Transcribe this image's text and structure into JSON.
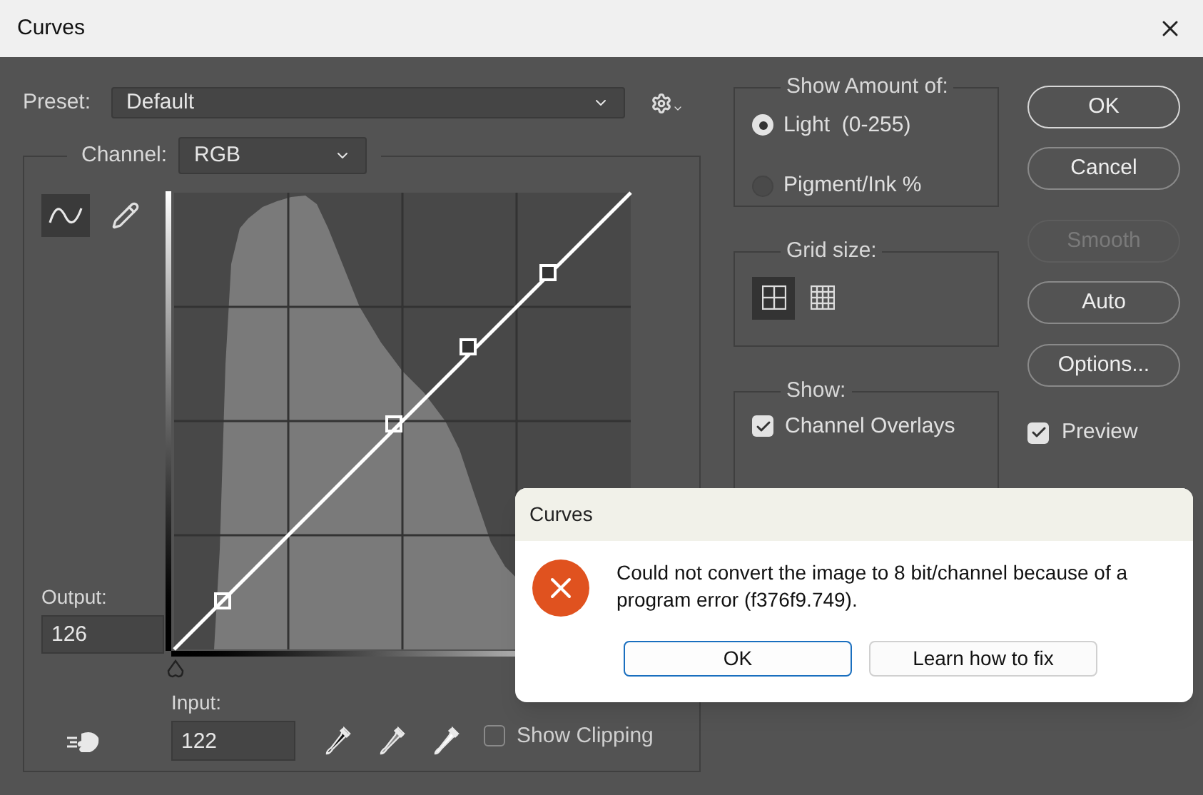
{
  "window": {
    "title": "Curves"
  },
  "preset": {
    "label": "Preset:",
    "value": "Default"
  },
  "channel": {
    "label": "Channel:",
    "value": "RGB"
  },
  "curve_tools": [
    {
      "kind": "curve",
      "selected": true
    },
    {
      "kind": "pencil",
      "selected": false
    }
  ],
  "output": {
    "label": "Output:",
    "value": "126"
  },
  "input": {
    "label": "Input:",
    "value": "122"
  },
  "show_clipping": {
    "label": "Show Clipping",
    "checked": false
  },
  "show_amount": {
    "title": "Show Amount of:",
    "options": [
      {
        "label": "Light  (0-255)",
        "selected": true
      },
      {
        "label": "Pigment/Ink %",
        "selected": false
      }
    ]
  },
  "grid_size": {
    "title": "Grid size:",
    "options": [
      {
        "kind": "simple",
        "selected": true
      },
      {
        "kind": "detailed",
        "selected": false
      }
    ]
  },
  "show": {
    "title": "Show:",
    "options": [
      {
        "label": "Channel Overlays",
        "checked": true
      }
    ]
  },
  "buttons": [
    {
      "label": "OK",
      "disabled": false,
      "default": true
    },
    {
      "label": "Cancel",
      "disabled": false,
      "default": false
    },
    {
      "label": "Smooth",
      "disabled": true,
      "default": false
    },
    {
      "label": "Auto",
      "disabled": false,
      "default": false
    },
    {
      "label": "Options...",
      "disabled": false,
      "default": false
    }
  ],
  "preview": {
    "label": "Preview",
    "checked": true
  },
  "error_dialog": {
    "title": "Curves",
    "message": "Could not convert the image to 8 bit/channel because of a program error (f376f9.749).",
    "buttons": [
      {
        "label": "OK",
        "selected": true
      },
      {
        "label": "Learn how to fix",
        "selected": false
      }
    ]
  }
}
